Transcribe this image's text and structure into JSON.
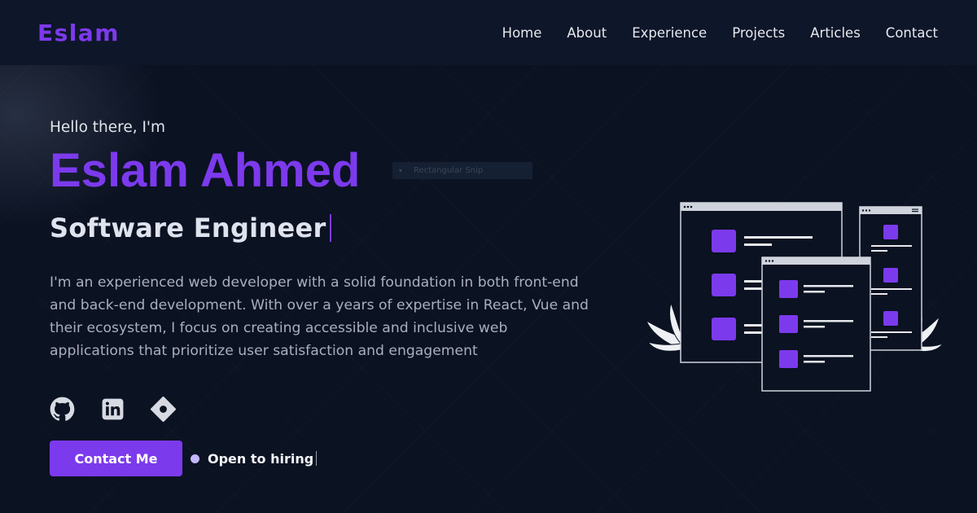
{
  "header": {
    "logo": "Eslam",
    "nav": [
      "Home",
      "About",
      "Experience",
      "Projects",
      "Articles",
      "Contact"
    ]
  },
  "hero": {
    "greeting": "Hello there, I'm",
    "name": "Eslam Ahmed",
    "role": "Software Engineer",
    "bio": "I'm an experienced web developer with a solid foundation in both front-end and back-end development. With over a years of expertise in React, Vue and their ecosystem, I focus on creating accessible and inclusive web applications that prioritize user satisfaction and engagement"
  },
  "socials": [
    {
      "icon": "github-icon"
    },
    {
      "icon": "linkedin-icon"
    },
    {
      "icon": "dev-community-icon"
    }
  ],
  "actions": {
    "contact_label": "Contact Me",
    "status_label": "Open to hiring"
  },
  "overlay": {
    "snip_label": "Rectangular Snip"
  },
  "colors": {
    "background": "#0b1222",
    "header": "#0e1629",
    "accent": "#7c3aed",
    "status_dot": "#c4b5fd"
  }
}
